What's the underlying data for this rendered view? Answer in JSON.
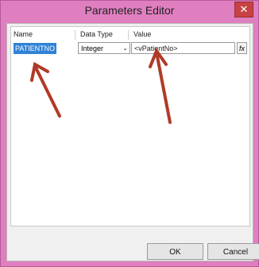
{
  "window": {
    "title": "Parameters Editor",
    "close_glyph": "✕"
  },
  "grid": {
    "headers": {
      "name": "Name",
      "data_type": "Data Type",
      "value": "Value"
    },
    "rows": [
      {
        "name": "PATIENTNO",
        "data_type": "Integer",
        "value": "<vPatientNo>",
        "expr_glyph": "fx"
      }
    ]
  },
  "buttons": {
    "ok": "OK",
    "cancel": "Cancel"
  },
  "colors": {
    "frame": "#e07fc0",
    "selection": "#2f82d7",
    "annotation_arrow": "#b03a26"
  },
  "icons": {
    "type_dropdown": "chevron-down-icon",
    "expression": "function-icon"
  }
}
